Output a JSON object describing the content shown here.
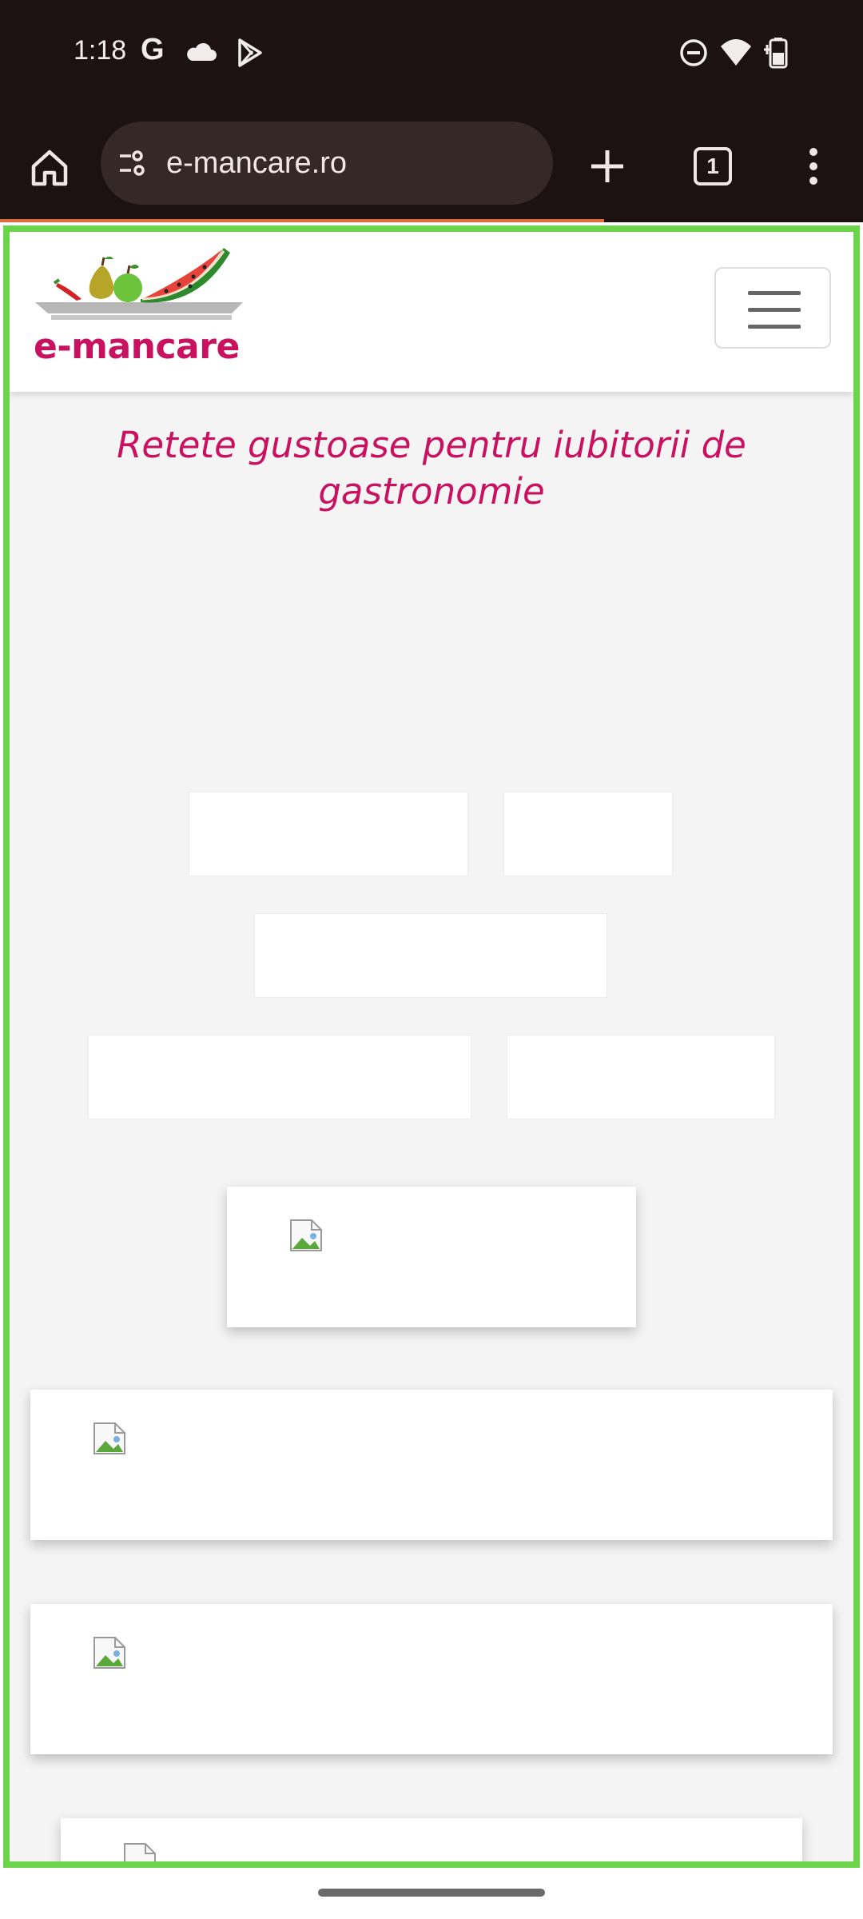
{
  "status_bar": {
    "time": "1:18",
    "icons": [
      "google-g-icon",
      "cloud-icon",
      "play-store-icon",
      "do-not-disturb-icon",
      "wifi-icon",
      "battery-icon"
    ],
    "google_letter": "G"
  },
  "browser": {
    "url": "e-mancare.ro",
    "tab_count": "1",
    "icons": [
      "home-icon",
      "site-settings-icon",
      "new-tab-icon",
      "tabs-icon",
      "more-menu-icon"
    ]
  },
  "site": {
    "logo_text": "e-mancare",
    "tagline": "Retete gustoase pentru iubitorii de gastronomie"
  },
  "colors": {
    "brand": "#c9115f",
    "chrome_bg": "#1c1212",
    "url_bar_bg": "#352927",
    "highlight": "#6bd44a",
    "page_bg": "#f4f4f4"
  }
}
